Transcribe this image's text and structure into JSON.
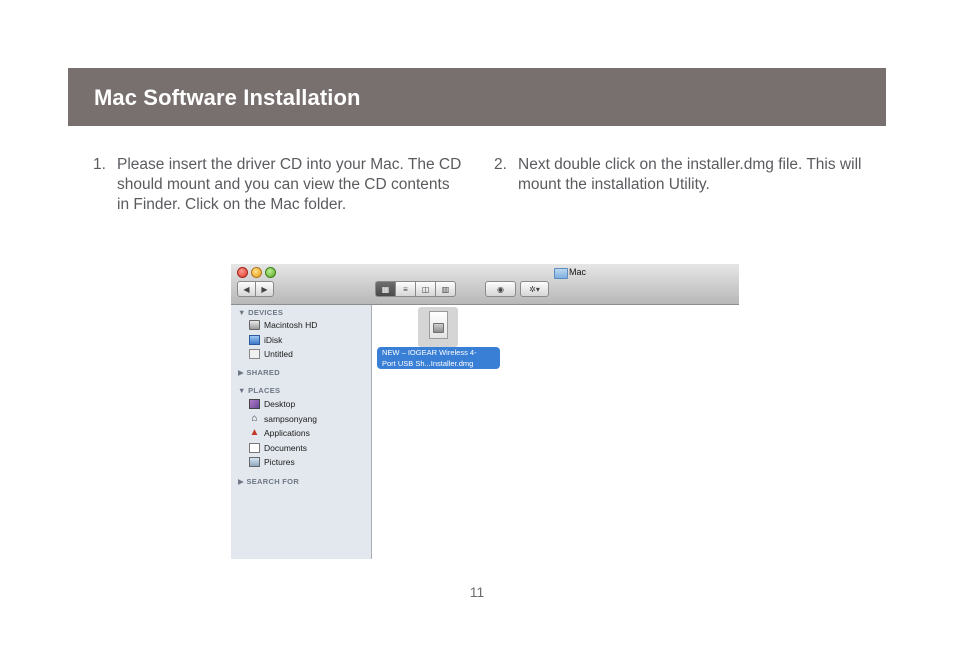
{
  "header": {
    "title": "Mac Software Installation"
  },
  "steps": [
    {
      "number": "1.",
      "text": "Please insert the driver CD into your Mac. The CD should mount and you can view the CD contents in Finder. Click on the Mac folder."
    },
    {
      "number": "2.",
      "text": "Next double click on the installer.dmg file. This will mount the installation Utility."
    }
  ],
  "finder": {
    "window_title": "Mac",
    "toolbar": {
      "back_glyph": "◀",
      "forward_glyph": "▶",
      "view_icon_glyph": "▦",
      "view_list_glyph": "≡",
      "view_column_glyph": "◫",
      "view_coverflow_glyph": "▥",
      "quicklook_glyph": "◉",
      "action_glyph": "✲▾"
    },
    "sidebar": {
      "devices_header": "▼ DEVICES",
      "devices": [
        "Macintosh HD",
        "iDisk",
        "Untitled"
      ],
      "shared_header": "▶ SHARED",
      "places_header": "▼ PLACES",
      "places": [
        "Desktop",
        "sampsonyang",
        "Applications",
        "Documents",
        "Pictures"
      ],
      "search_header": "▶ SEARCH FOR"
    },
    "file": {
      "name_line1": "NEW – IOGEAR Wireless 4-",
      "name_line2": "Port USB Sh...Installer.dmg"
    },
    "icons": {
      "home_glyph": "⌂",
      "apps_glyph": "▲"
    }
  },
  "footer": {
    "page_number": "11"
  },
  "colors": {
    "header_bar": "#77706f",
    "selection_blue": "#3a7fd6",
    "sidebar_bg": "#e3e8ee"
  }
}
